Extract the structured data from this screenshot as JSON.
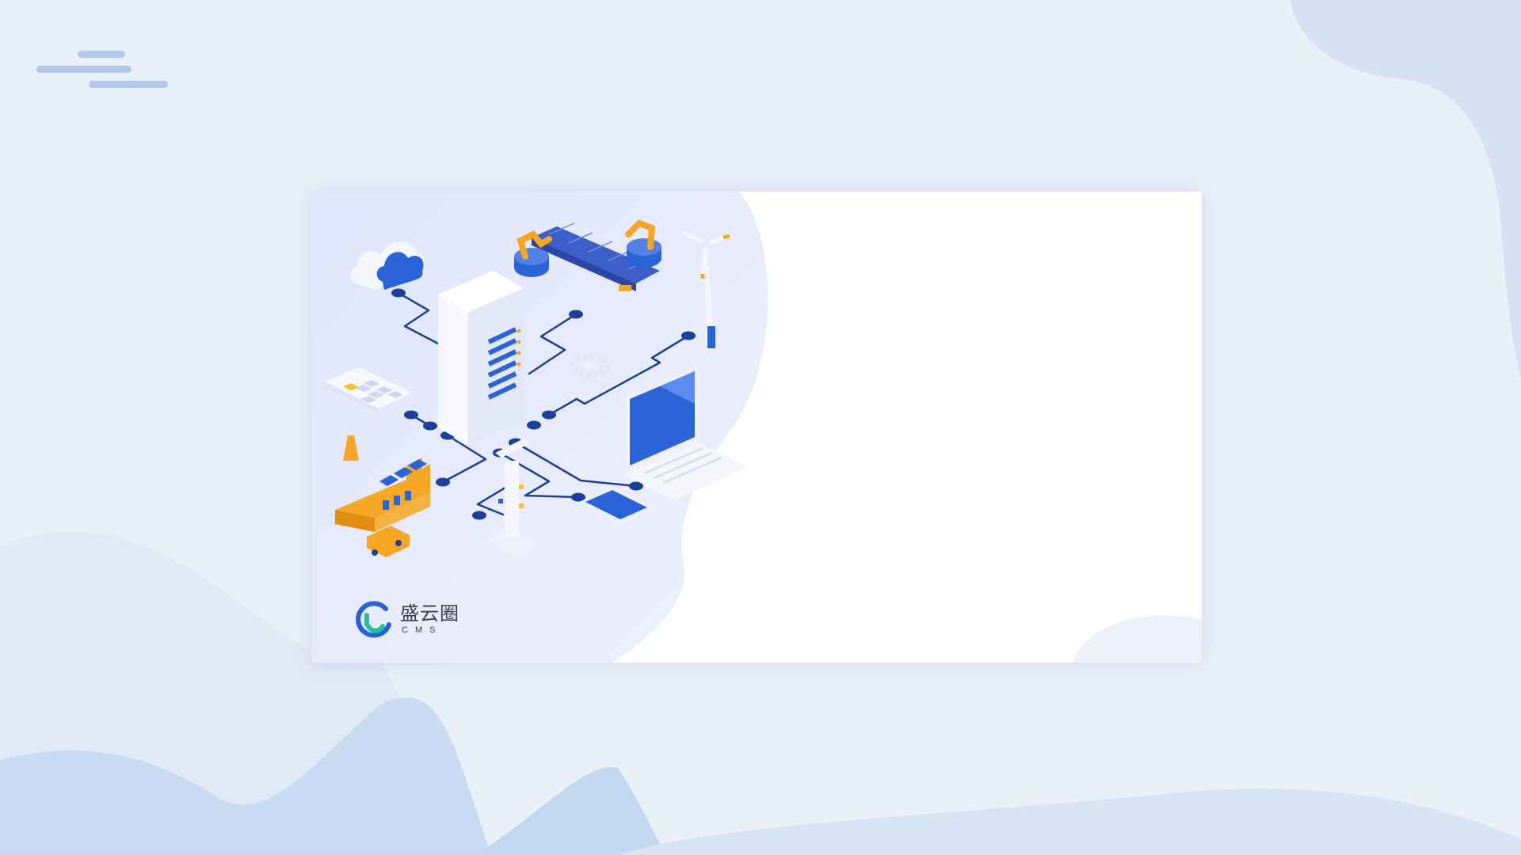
{
  "app": {
    "brand_name": "盛云圈",
    "brand_sub": "CMS"
  },
  "icons": {
    "cloud": "cloud-icon",
    "server": "server-icon",
    "robot_arm": "robot-arm-icon",
    "wind_turbine": "wind-turbine-icon",
    "calculator": "calculator-icon",
    "laptop": "laptop-icon",
    "tablet": "tablet-icon",
    "factory": "factory-icon",
    "gear": "gear-icon"
  },
  "colors": {
    "page_background": "#eaf0f8",
    "accent_blue": "#2b63d9",
    "circuit_navy": "#1c3f9b",
    "accent_orange": "#f6a623",
    "logo_blue": "#2b5fd6",
    "logo_teal": "#22c0a0"
  }
}
